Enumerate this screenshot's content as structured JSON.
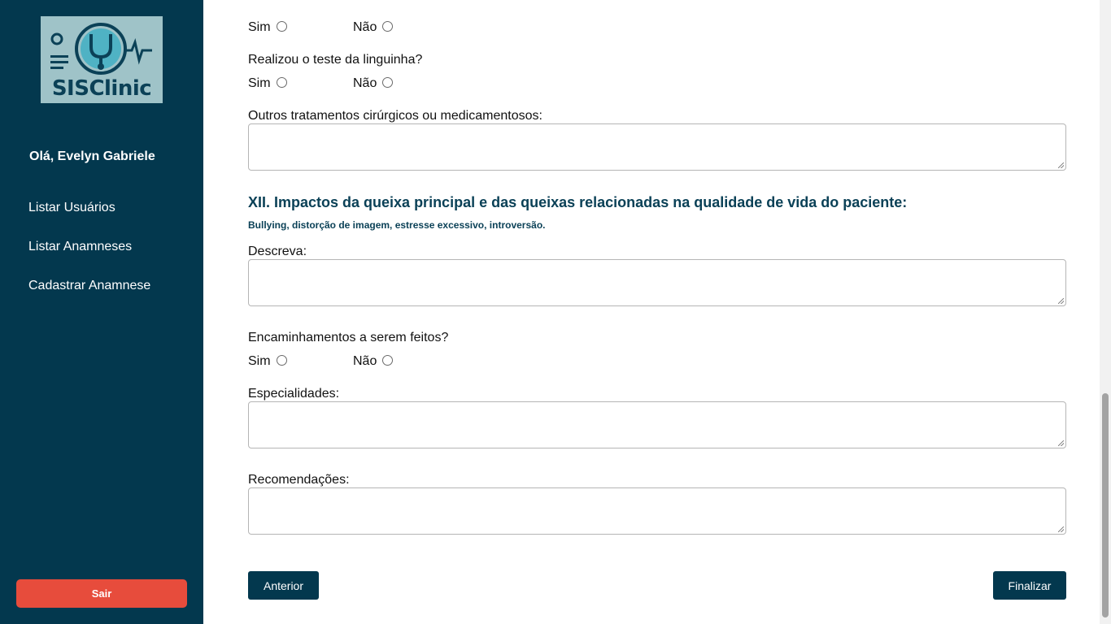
{
  "sidebar": {
    "logo_text": "SISClinic",
    "greeting": "Olá, Evelyn Gabriele",
    "nav": [
      {
        "label": "Listar Usuários"
      },
      {
        "label": "Listar Anamneses"
      },
      {
        "label": "Cadastrar Anamnese"
      }
    ],
    "logout_label": "Sair"
  },
  "form": {
    "top_radio": {
      "yes": "Sim",
      "no": "Não"
    },
    "tongue_test": {
      "question": "Realizou o teste da linguinha?",
      "yes": "Sim",
      "no": "Não"
    },
    "other_treatments": {
      "label": "Outros tratamentos cirúrgicos ou medicamentosos:",
      "value": ""
    },
    "section": {
      "title": "XII. Impactos da queixa principal e das queixas relacionadas na qualidade de vida do paciente:",
      "subtitle": "Bullying, distorção de imagem, estresse excessivo, introversão."
    },
    "describe": {
      "label": "Descreva:",
      "value": ""
    },
    "referrals": {
      "question": "Encaminhamentos a serem feitos?",
      "yes": "Sim",
      "no": "Não"
    },
    "specialties": {
      "label": "Especialidades:",
      "value": ""
    },
    "recommendations": {
      "label": "Recomendações:",
      "value": ""
    },
    "buttons": {
      "previous": "Anterior",
      "finish": "Finalizar"
    }
  },
  "colors": {
    "sidebar_bg": "#03384e",
    "accent": "#0b4157",
    "logout": "#e74c3c"
  }
}
